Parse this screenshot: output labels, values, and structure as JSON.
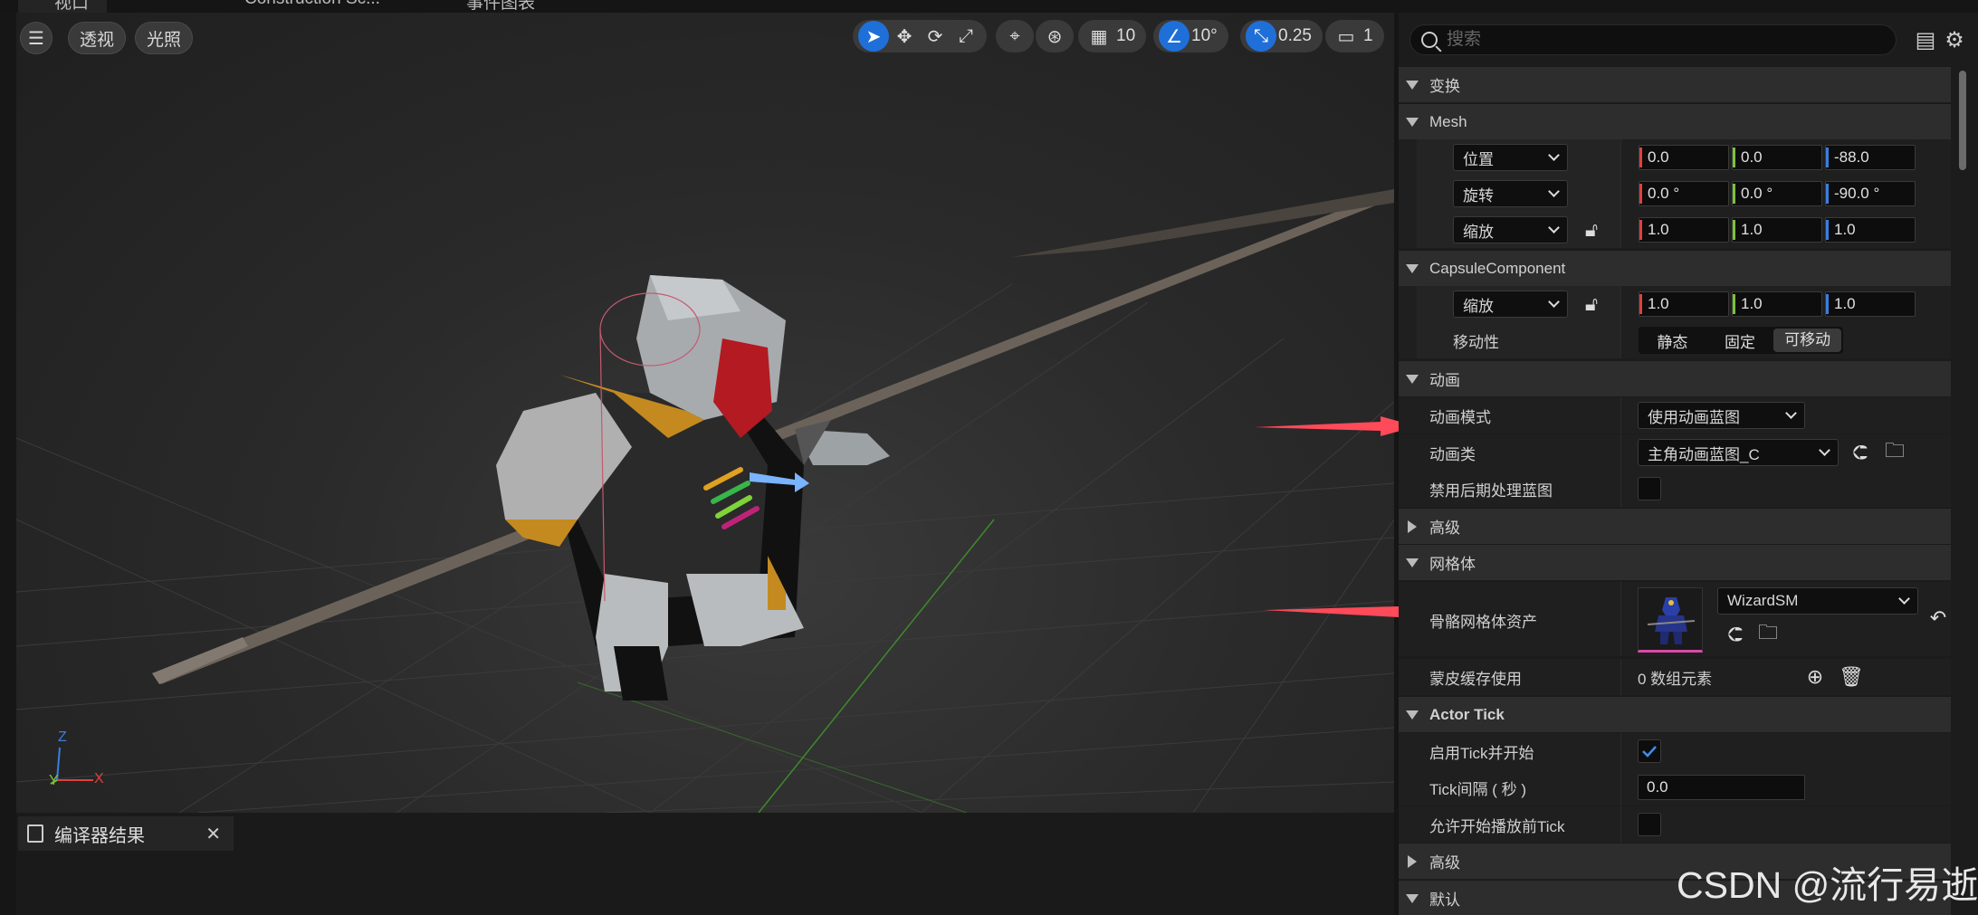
{
  "tabs": {
    "viewport": "视口",
    "construction": "Construction Sc...",
    "event_graph": "事件图表"
  },
  "viewport": {
    "menu_icon": "hamburger-icon",
    "perspective": "透视",
    "lighting": "光照",
    "grid_snap": "10",
    "rotation_snap": "10°",
    "scale_snap": "0.25",
    "camera_speed": "1",
    "axis_labels": {
      "z": "Z",
      "y": "Y",
      "x": "X"
    }
  },
  "bottom_panel": {
    "tab_label": "编译器结果"
  },
  "details": {
    "search_placeholder": "搜索",
    "categories": {
      "transform": "变换",
      "mesh": "Mesh",
      "capsule": "CapsuleComponent",
      "animation": "动画",
      "advanced1": "高级",
      "mesh_body": "网格体",
      "actor_tick": "Actor Tick",
      "advanced2": "高级",
      "default": "默认"
    },
    "mesh": {
      "location_label": "位置",
      "location": [
        "0.0",
        "0.0",
        "-88.0"
      ],
      "rotation_label": "旋转",
      "rotation": [
        "0.0 °",
        "0.0 °",
        "-90.0 °"
      ],
      "scale_label": "缩放",
      "scale": [
        "1.0",
        "1.0",
        "1.0"
      ]
    },
    "capsule": {
      "scale_label": "缩放",
      "scale": [
        "1.0",
        "1.0",
        "1.0"
      ],
      "mobility_label": "移动性",
      "mobility_options": [
        "静态",
        "固定",
        "可移动"
      ],
      "mobility_selected": "可移动"
    },
    "animation": {
      "mode_label": "动画模式",
      "mode_value": "使用动画蓝图",
      "class_label": "动画类",
      "class_value": "主角动画蓝图_C",
      "disable_post_label": "禁用后期处理蓝图"
    },
    "mesh_body": {
      "skeletal_label": "骨骼网格体资产",
      "skeletal_value": "WizardSM",
      "skin_cache_label": "蒙皮缓存使用",
      "skin_cache_value": "0 数组元素"
    },
    "actor_tick": {
      "start_label": "启用Tick并开始",
      "start_checked": true,
      "interval_label": "Tick间隔 ( 秒 )",
      "interval_value": "0.0",
      "allow_before_label": "允许开始播放前Tick",
      "allow_before_checked": false
    }
  },
  "watermark": "CSDN @流行易逝",
  "colors": {
    "accent": "#1f6fd8",
    "arrow": "#ff4a5a",
    "x_axis": "#e04040",
    "y_axis": "#7cc238",
    "z_axis": "#3a7fe0"
  }
}
